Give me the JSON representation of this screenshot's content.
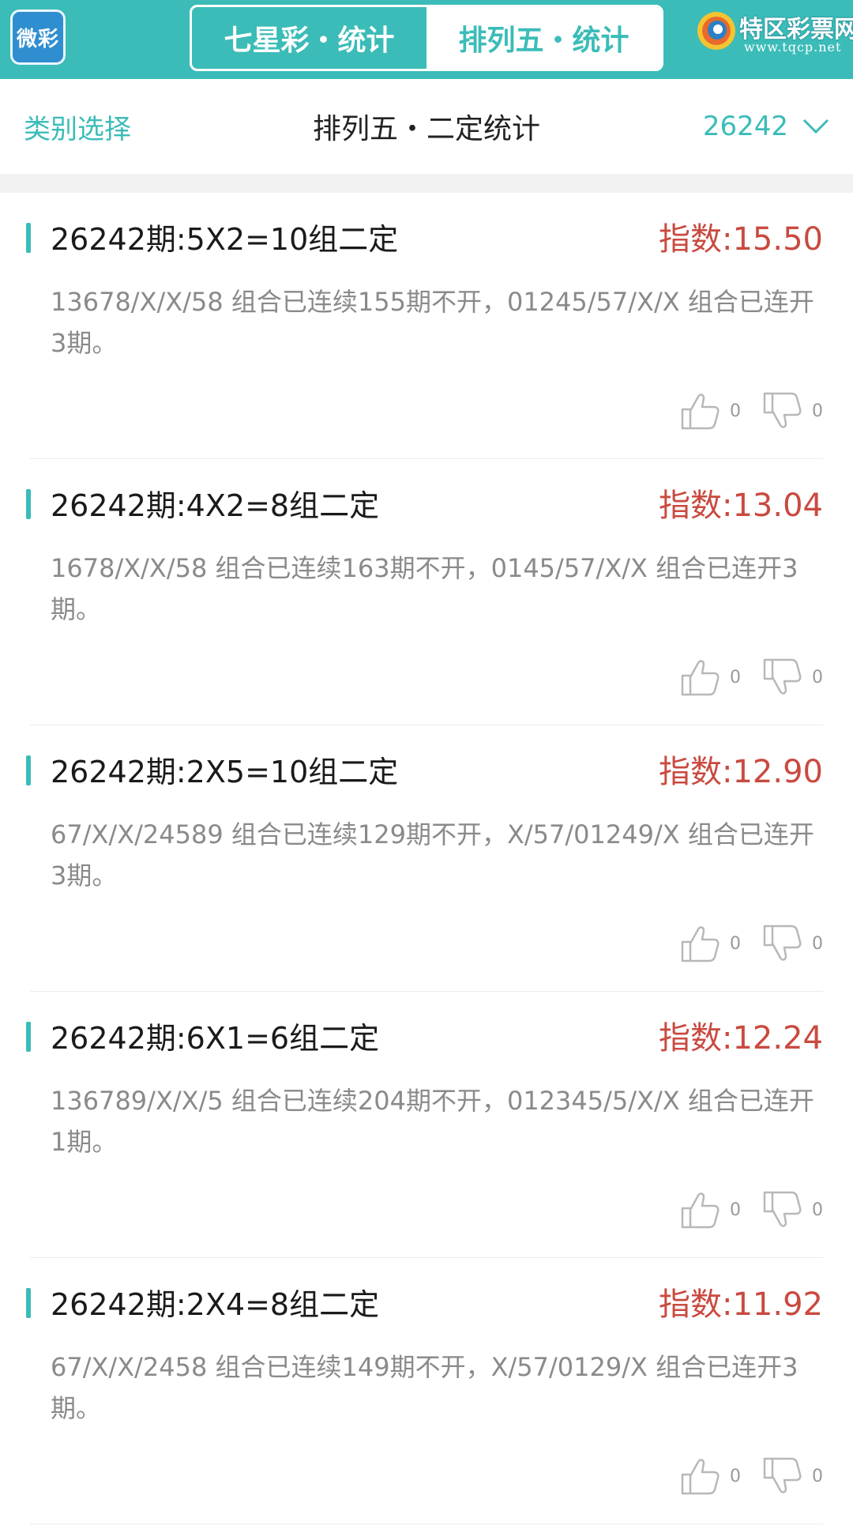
{
  "header": {
    "app_logo_text": "微彩",
    "tabs": [
      {
        "label": "七星彩・统计",
        "active": false
      },
      {
        "label": "排列五・统计",
        "active": true
      }
    ],
    "brand_name": "特区彩票网",
    "brand_url": "www.tqcp.net"
  },
  "subheader": {
    "category_label": "类别选择",
    "title": "排列五・二定统计",
    "period": "26242"
  },
  "cards": [
    {
      "title": "26242期:5X2=10组二定",
      "index": "指数:15.50",
      "desc": "13678/X/X/58 组合已连续155期不开，01245/57/X/X 组合已连开3期。",
      "likes": "0",
      "dislikes": "0"
    },
    {
      "title": "26242期:4X2=8组二定",
      "index": "指数:13.04",
      "desc": "1678/X/X/58 组合已连续163期不开，0145/57/X/X 组合已连开3期。",
      "likes": "0",
      "dislikes": "0"
    },
    {
      "title": "26242期:2X5=10组二定",
      "index": "指数:12.90",
      "desc": "67/X/X/24589 组合已连续129期不开，X/57/01249/X 组合已连开3期。",
      "likes": "0",
      "dislikes": "0"
    },
    {
      "title": "26242期:6X1=6组二定",
      "index": "指数:12.24",
      "desc": "136789/X/X/5 组合已连续204期不开，012345/5/X/X 组合已连开1期。",
      "likes": "0",
      "dislikes": "0"
    },
    {
      "title": "26242期:2X4=8组二定",
      "index": "指数:11.92",
      "desc": "67/X/X/2458 组合已连续149期不开，X/57/0129/X 组合已连开3期。",
      "likes": "0",
      "dislikes": "0"
    }
  ],
  "colors": {
    "accent": "#3bbcb8",
    "index_red": "#c94a3f",
    "desc_gray": "#8a8a8a"
  },
  "icons": {
    "like": "thumbs-up-icon",
    "dislike": "thumbs-down-icon",
    "dropdown": "chevron-down-icon"
  }
}
